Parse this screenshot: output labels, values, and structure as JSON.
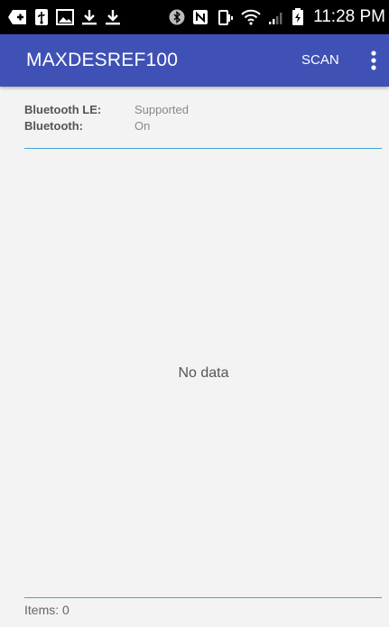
{
  "status_bar": {
    "time": "11:28 PM",
    "icons": [
      "add-box-icon",
      "usb-icon",
      "image-icon",
      "download-icon",
      "download-icon",
      "bluetooth-icon",
      "nfc-icon",
      "vibrate-icon",
      "wifi-icon",
      "signal-icon",
      "battery-charging-icon"
    ]
  },
  "app_bar": {
    "title": "MAXDESREF100",
    "scan_label": "SCAN",
    "overflow_icon": "more-vert-icon",
    "color": "#3f51b5"
  },
  "info": {
    "ble_label": "Bluetooth LE:",
    "ble_value": "Supported",
    "bt_label": "Bluetooth:",
    "bt_value": "On"
  },
  "list": {
    "empty_text": "No data"
  },
  "footer": {
    "items_text": "Items: 0"
  },
  "colors": {
    "accent": "#3fa7d6",
    "background": "#f3f3f3"
  }
}
